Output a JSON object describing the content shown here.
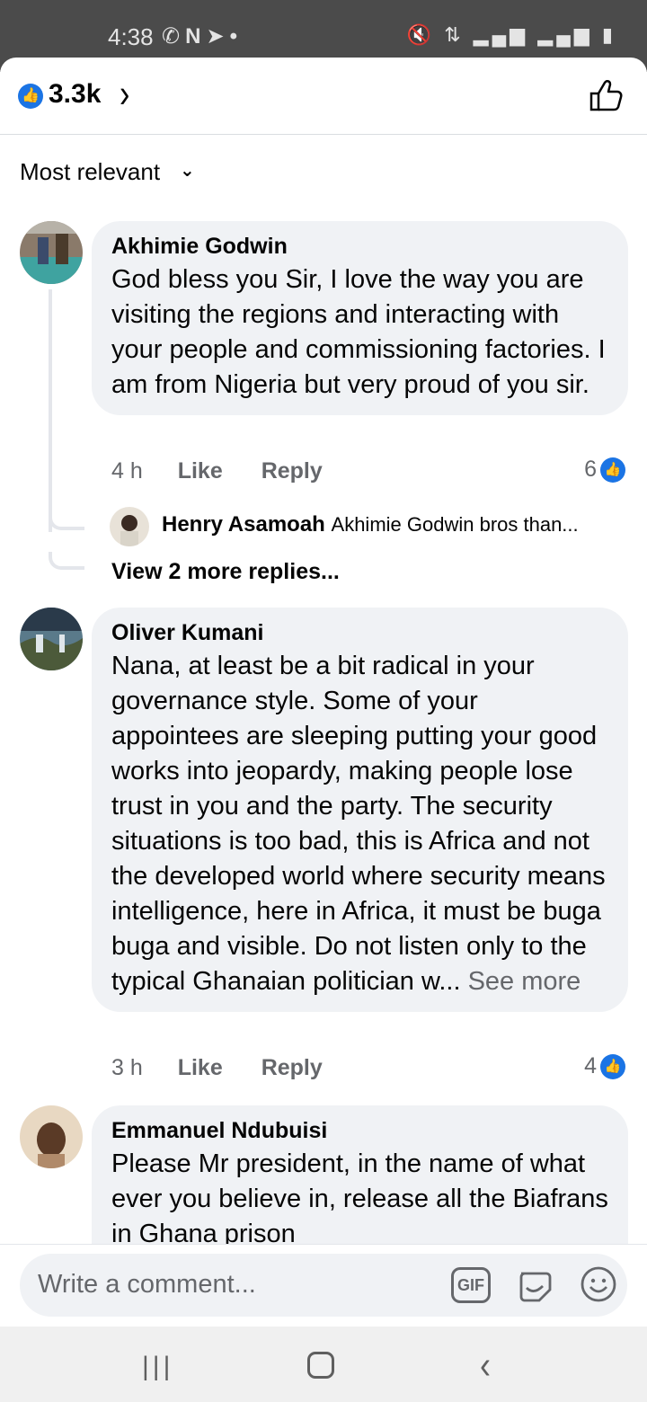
{
  "status_bar": {
    "time": "4:38",
    "left_icons": [
      "whatsapp-icon",
      "n-app-icon",
      "telegram-icon",
      "dot-icon"
    ],
    "right_icons": [
      "mute-icon",
      "data-icon",
      "signal-icon",
      "signal-icon",
      "battery-icon"
    ]
  },
  "reactions": {
    "count": "3.3k",
    "icon": "like-badge-icon",
    "color": "#1b74e4"
  },
  "sort": {
    "label": "Most relevant"
  },
  "comments": [
    {
      "author": "Akhimie Godwin",
      "text": "God bless you Sir, I love the way you are visiting the regions and interacting with your people and commissioning factories. I am from Nigeria but very proud of you sir.",
      "time": "4 h",
      "like_label": "Like",
      "reply_label": "Reply",
      "reactions": "6",
      "reply_preview": {
        "author": "Henry Asamoah",
        "text": "Akhimie Godwin bros than..."
      },
      "view_more": "View 2 more replies..."
    },
    {
      "author": "Oliver Kumani",
      "text": "Nana, at least be a bit radical in your governance style. Some of your appointees are sleeping putting your good works into jeopardy, making people lose trust in you and the party. The security situations is too bad, this is Africa and not the developed world where security means intelligence, here in Africa, it must be buga buga and visible. Do not listen only to the typical Ghanaian politician w...",
      "see_more": "See more",
      "time": "3 h",
      "like_label": "Like",
      "reply_label": "Reply",
      "reactions": "4"
    },
    {
      "author": "Emmanuel Ndubuisi",
      "text": "Please Mr president, in the name of what ever you believe in, release all the Biafrans in Ghana prison"
    }
  ],
  "composer": {
    "placeholder": "Write a comment...",
    "gif_label": "GIF"
  }
}
